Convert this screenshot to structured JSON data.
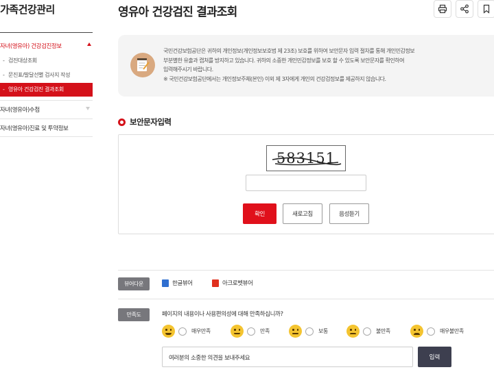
{
  "sidebar": {
    "title": "가족건강관리",
    "section1": "자녀(영유아) 건강검진정보",
    "items": [
      {
        "label": "검진대상조회"
      },
      {
        "label": "문진표/발달선별 검사지 작성"
      },
      {
        "label": "영유아 건강검진 결과조회"
      }
    ],
    "section2": "자녀(영유아)수첩",
    "section3": "자녀(영유아)진료 및 투약정보"
  },
  "header": {
    "title": "영유아 건강검진 결과조회",
    "icons": [
      "print-icon",
      "share-icon",
      "bookmark-icon"
    ]
  },
  "notice": {
    "lines": [
      "국민건강보험공단은 귀하의 개인정보(개인정보보호법 제 23조) 보호를 위하여 보안문자 입력 절차를 통해 개인민감정보",
      "부분별한 유출과 캡쳐를 방지하고 있습니다. 귀하의 소중한 개인민감정보를 보호 할 수 있도록 보안문자를 확인하여",
      "입력해주시기 바랍니다.",
      "※ 국민건강보험공단에서는 개인정보주체(본인) 이외 제 3자에게 개인의 건강검정보를 제공하지 않습니다."
    ]
  },
  "security": {
    "heading": "보안문자입력",
    "captcha": "583151",
    "input_value": "",
    "confirm": "확인",
    "refresh": "새로고침",
    "audio": "음성듣기"
  },
  "viewer": {
    "chip": "뷰어다운",
    "hangul": "한글뷰어",
    "acrobat": "아크로벳뷰어"
  },
  "satisfaction": {
    "chip": "만족도",
    "question": "페이지의 내용이나 사용편의성에 대해 만족하십니까?",
    "options": [
      "매우만족",
      "만족",
      "보통",
      "불만족",
      "매우불만족"
    ],
    "opinion_placeholder": "여러분의 소중한 의견을 보내주세요",
    "submit": "입력"
  },
  "colors": {
    "accent": "#d4111a",
    "submit": "#3d3f4f",
    "chip": "#77777c"
  }
}
